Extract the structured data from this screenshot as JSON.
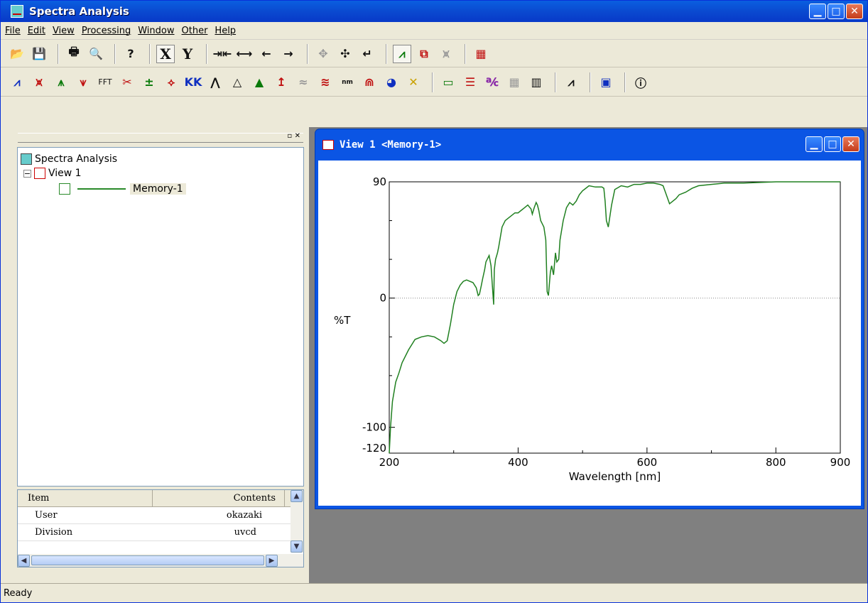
{
  "app": {
    "title": "Spectra Analysis"
  },
  "menu": [
    "File",
    "Edit",
    "View",
    "Processing",
    "Window",
    "Other",
    "Help"
  ],
  "toolbar1": [
    "open-icon",
    "save-icon",
    "|",
    "print-icon",
    "print-preview-icon",
    "|",
    "help-icon",
    "|",
    "X",
    "Y",
    "|",
    "⇥⇤",
    "⟷",
    "←",
    "→",
    "|",
    "✥",
    "✣",
    "↵",
    "|",
    "spectrum-view-icon",
    "zoom-view-icon",
    "disabled-peak-icon",
    "|",
    "overlay-icon"
  ],
  "toolbar2": [
    "smooth-icon",
    "derivative-icon",
    "peak-pick-icon",
    "baseline-icon",
    "FFT",
    "cut-icon",
    "arith-icon",
    "normalize-icon",
    "kk-icon",
    "deconv-icon",
    "peak-area-icon",
    "fill-peak-icon",
    "peak-height-icon",
    "diff-icon",
    "convert-icon",
    "nm/cm-icon",
    "bandwidth-icon",
    "color-icon",
    "cursor-icon",
    "|",
    "frame-icon",
    "legend-icon",
    "text-icon",
    "grid-icon",
    "bar-icon",
    "|",
    "peak-list-icon",
    "|",
    "report-icon",
    "|",
    "info-icon"
  ],
  "tree": {
    "root": "Spectra Analysis",
    "view": "View 1",
    "memory": "Memory-1"
  },
  "properties": {
    "headers": [
      "Item",
      "Contents"
    ],
    "rows": [
      [
        "User",
        "okazaki"
      ],
      [
        "Division",
        "uvcd"
      ]
    ]
  },
  "child_window": {
    "title": "View 1 <Memory-1>"
  },
  "chart_data": {
    "type": "line",
    "xlabel": "Wavelength [nm]",
    "ylabel": "%T",
    "xlim": [
      200,
      900
    ],
    "ylim": [
      -120,
      90
    ],
    "x_ticks": [
      200,
      400,
      600,
      800,
      900
    ],
    "y_ticks": [
      90,
      0,
      -100,
      -120
    ],
    "zero_line": true,
    "series": [
      {
        "color": "#208020",
        "x": [
          200,
          202,
          205,
          210,
          215,
          220,
          230,
          240,
          250,
          260,
          270,
          280,
          285,
          290,
          295,
          300,
          305,
          310,
          315,
          320,
          325,
          330,
          335,
          338,
          340,
          343,
          345,
          348,
          350,
          355,
          358,
          360,
          362,
          363,
          365,
          368,
          370,
          375,
          380,
          385,
          390,
          395,
          400,
          405,
          410,
          415,
          420,
          422,
          425,
          428,
          430,
          432,
          435,
          440,
          443,
          445,
          447,
          450,
          452,
          455,
          458,
          460,
          463,
          465,
          470,
          475,
          480,
          485,
          490,
          495,
          500,
          505,
          510,
          520,
          530,
          533,
          535,
          537,
          540,
          545,
          550,
          560,
          570,
          580,
          590,
          600,
          610,
          620,
          625,
          630,
          635,
          640,
          645,
          650,
          660,
          670,
          680,
          700,
          720,
          750,
          800,
          850,
          900
        ],
        "y": [
          -120,
          -100,
          -80,
          -65,
          -58,
          -50,
          -40,
          -32,
          -30,
          -29,
          -30,
          -33,
          -35,
          -33,
          -20,
          -5,
          5,
          10,
          13,
          14,
          13,
          12,
          8,
          2,
          3,
          10,
          15,
          22,
          28,
          33,
          25,
          10,
          -5,
          22,
          30,
          35,
          40,
          55,
          60,
          62,
          64,
          66,
          66,
          68,
          70,
          72,
          69,
          65,
          70,
          74,
          72,
          68,
          60,
          55,
          45,
          5,
          2,
          20,
          25,
          18,
          35,
          28,
          30,
          45,
          60,
          70,
          74,
          72,
          75,
          80,
          83,
          85,
          87,
          86,
          86,
          85,
          75,
          60,
          55,
          72,
          84,
          87,
          86,
          88,
          88,
          89,
          89,
          88,
          87,
          80,
          73,
          75,
          77,
          80,
          82,
          85,
          87,
          88,
          89,
          89,
          90,
          90,
          90
        ]
      }
    ]
  },
  "status": {
    "text": "Ready"
  }
}
